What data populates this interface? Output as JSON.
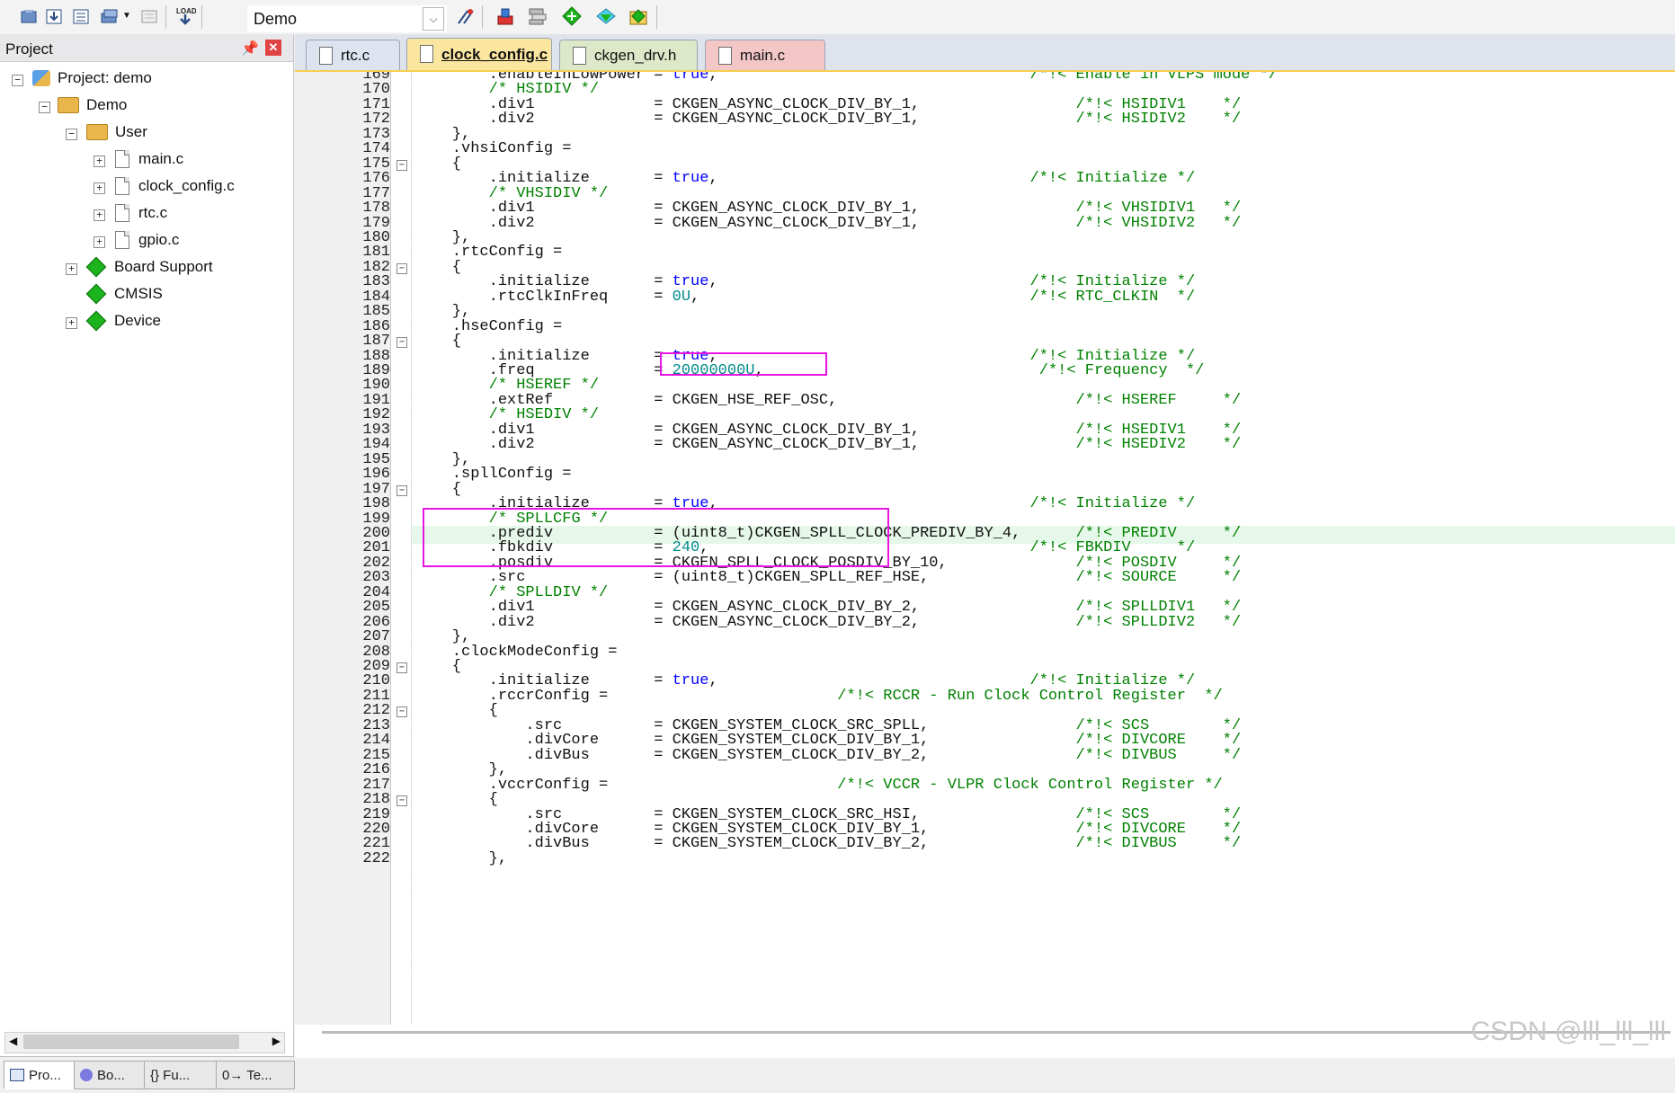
{
  "toolbar": {
    "target_name": "Demo",
    "icons": [
      "build-icon",
      "rebuild-icon",
      "batch-build-icon",
      "translate-icon",
      "stop-build-icon",
      "download-icon",
      "target-options-icon",
      "manage-components-icon",
      "run-time-env-icon",
      "pack-installer-icon",
      "select-packs-icon"
    ]
  },
  "project_panel": {
    "title": "Project",
    "tree": {
      "root": "Project: demo",
      "target": "Demo",
      "group": "User",
      "files": [
        "main.c",
        "clock_config.c",
        "rtc.c",
        "gpio.c"
      ],
      "components": [
        "Board Support",
        "CMSIS",
        "Device"
      ]
    },
    "bottom_tabs": [
      "Pro...",
      "Bo...",
      "{} Fu...",
      "0→ Te..."
    ]
  },
  "editor_tabs": [
    {
      "label": "rtc.c",
      "active": false,
      "color": "#dde3ef"
    },
    {
      "label": "clock_config.c",
      "active": true,
      "color": "#fbe6a0"
    },
    {
      "label": "ckgen_drv.h",
      "active": false,
      "color": "#dce8c8"
    },
    {
      "label": "main.c",
      "active": false,
      "color": "#f4c7c7"
    }
  ],
  "code": {
    "lines": [
      {
        "n": "169",
        "text": "        .enableInLowPower = <kw>true</kw>,                                  <cm>/*!< Enable in VLPS mode */</cm>"
      },
      {
        "n": "170",
        "text": "        <cm>/* HSIDIV */</cm>"
      },
      {
        "n": "171",
        "text": "        .div1             = CKGEN_ASYNC_CLOCK_DIV_BY_1,                 <cm>/*!< HSIDIV1    */</cm>"
      },
      {
        "n": "172",
        "text": "        .div2             = CKGEN_ASYNC_CLOCK_DIV_BY_1,                 <cm>/*!< HSIDIV2    */</cm>"
      },
      {
        "n": "173",
        "text": "    },"
      },
      {
        "n": "174",
        "text": "    .vhsiConfig ="
      },
      {
        "n": "175",
        "text": "    {"
      },
      {
        "n": "176",
        "text": "        .initialize       = <kw>true</kw>,                                  <cm>/*!< Initialize */</cm>"
      },
      {
        "n": "177",
        "text": "        <cm>/* VHSIDIV */</cm>"
      },
      {
        "n": "178",
        "text": "        .div1             = CKGEN_ASYNC_CLOCK_DIV_BY_1,                 <cm>/*!< VHSIDIV1   */</cm>"
      },
      {
        "n": "179",
        "text": "        .div2             = CKGEN_ASYNC_CLOCK_DIV_BY_1,                 <cm>/*!< VHSIDIV2   */</cm>"
      },
      {
        "n": "180",
        "text": "    },"
      },
      {
        "n": "181",
        "text": "    .rtcConfig ="
      },
      {
        "n": "182",
        "text": "    {"
      },
      {
        "n": "183",
        "text": "        .initialize       = <kw>true</kw>,                                  <cm>/*!< Initialize */</cm>"
      },
      {
        "n": "184",
        "text": "        .rtcClkInFreq     = <num>0U</num>,                                    <cm>/*!< RTC_CLKIN  */</cm>"
      },
      {
        "n": "185",
        "text": "    },"
      },
      {
        "n": "186",
        "text": "    .hseConfig ="
      },
      {
        "n": "187",
        "text": "    {"
      },
      {
        "n": "188",
        "text": "        .initialize       = <kw>true</kw>,                                  <cm>/*!< Initialize */</cm>"
      },
      {
        "n": "189",
        "text": "        .freq             = <num>20000000U</num>,                              <cm>/*!< Frequency  */</cm>"
      },
      {
        "n": "190",
        "text": "        <cm>/* HSEREF */</cm>"
      },
      {
        "n": "191",
        "text": "        .extRef           = CKGEN_HSE_REF_OSC,                          <cm>/*!< HSEREF     */</cm>"
      },
      {
        "n": "192",
        "text": "        <cm>/* HSEDIV */</cm>"
      },
      {
        "n": "193",
        "text": "        .div1             = CKGEN_ASYNC_CLOCK_DIV_BY_1,                 <cm>/*!< HSEDIV1    */</cm>"
      },
      {
        "n": "194",
        "text": "        .div2             = CKGEN_ASYNC_CLOCK_DIV_BY_1,                 <cm>/*!< HSEDIV2    */</cm>"
      },
      {
        "n": "195",
        "text": "    },"
      },
      {
        "n": "196",
        "text": "    .spllConfig ="
      },
      {
        "n": "197",
        "text": "    {"
      },
      {
        "n": "198",
        "text": "        .initialize       = <kw>true</kw>,                                  <cm>/*!< Initialize */</cm>"
      },
      {
        "n": "199",
        "text": "        <cm>/* SPLLCFG */</cm>"
      },
      {
        "n": "200",
        "text": "        .prediv           = (uint8_t)CKGEN_SPLL_CLOCK_PREDIV_BY_4,      <cm>/*!< PREDIV     */</cm>"
      },
      {
        "n": "201",
        "text": "        .fbkdiv           = <num>240</num>,                                   <cm>/*!< FBKDIV     */</cm>"
      },
      {
        "n": "202",
        "text": "        .posdiv           = CKGEN_SPLL_CLOCK_POSDIV_BY_10,              <cm>/*!< POSDIV     */</cm>"
      },
      {
        "n": "203",
        "text": "        .src              = (uint8_t)CKGEN_SPLL_REF_HSE,                <cm>/*!< SOURCE     */</cm>"
      },
      {
        "n": "204",
        "text": "        <cm>/* SPLLDIV */</cm>"
      },
      {
        "n": "205",
        "text": "        .div1             = CKGEN_ASYNC_CLOCK_DIV_BY_2,                 <cm>/*!< SPLLDIV1   */</cm>"
      },
      {
        "n": "206",
        "text": "        .div2             = CKGEN_ASYNC_CLOCK_DIV_BY_2,                 <cm>/*!< SPLLDIV2   */</cm>"
      },
      {
        "n": "207",
        "text": "    },"
      },
      {
        "n": "208",
        "text": "    .clockModeConfig ="
      },
      {
        "n": "209",
        "text": "    {"
      },
      {
        "n": "210",
        "text": "        .initialize       = <kw>true</kw>,                                  <cm>/*!< Initialize */</cm>"
      },
      {
        "n": "211",
        "text": "        .rccrConfig =                         <cm>/*!< RCCR - Run Clock Control Register  */</cm>"
      },
      {
        "n": "212",
        "text": "        {"
      },
      {
        "n": "213",
        "text": "            .src          = CKGEN_SYSTEM_CLOCK_SRC_SPLL,                <cm>/*!< SCS        */</cm>"
      },
      {
        "n": "214",
        "text": "            .divCore      = CKGEN_SYSTEM_CLOCK_DIV_BY_1,                <cm>/*!< DIVCORE    */</cm>"
      },
      {
        "n": "215",
        "text": "            .divBus       = CKGEN_SYSTEM_CLOCK_DIV_BY_2,                <cm>/*!< DIVBUS     */</cm>"
      },
      {
        "n": "216",
        "text": "        },"
      },
      {
        "n": "217",
        "text": "        .vccrConfig =                         <cm>/*!< VCCR - VLPR Clock Control Register */</cm>"
      },
      {
        "n": "218",
        "text": "        {"
      },
      {
        "n": "219",
        "text": "            .src          = CKGEN_SYSTEM_CLOCK_SRC_HSI,                 <cm>/*!< SCS        */</cm>"
      },
      {
        "n": "220",
        "text": "            .divCore      = CKGEN_SYSTEM_CLOCK_DIV_BY_1,                <cm>/*!< DIVCORE    */</cm>"
      },
      {
        "n": "221",
        "text": "            .divBus       = CKGEN_SYSTEM_CLOCK_DIV_BY_2,                <cm>/*!< DIVBUS     */</cm>"
      },
      {
        "n": "222",
        "text": "        },"
      }
    ],
    "fold_lines": [
      "175",
      "182",
      "187",
      "197",
      "209",
      "212",
      "218"
    ],
    "highlighted_line": "200"
  },
  "watermark": "CSDN @lll_lll_lll",
  "colors": {
    "keyword": "#0000ff",
    "number": "#008a8a",
    "comment": "#008000",
    "highlight": "#e6f8ea",
    "annotation_box": "#e815e0"
  }
}
